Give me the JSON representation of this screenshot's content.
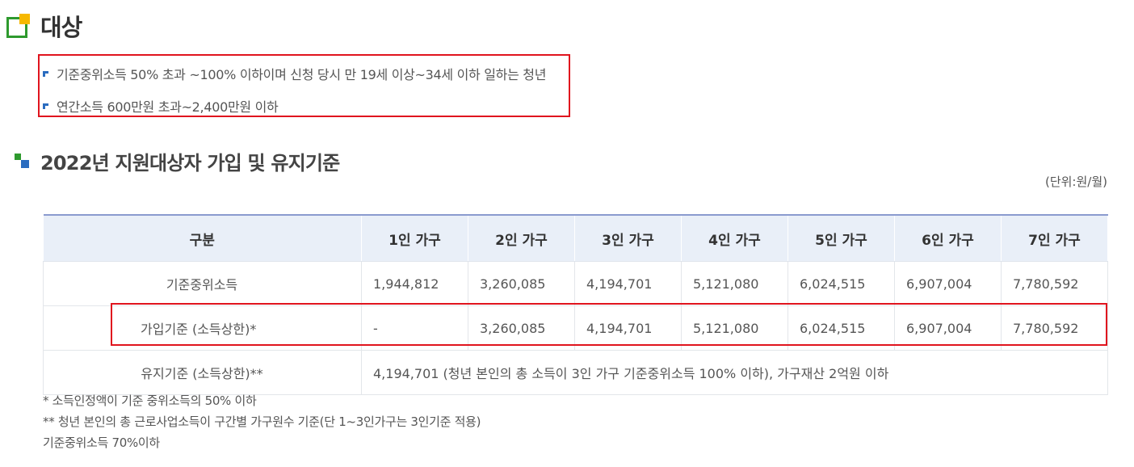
{
  "section": {
    "title": "대상"
  },
  "target": {
    "items": [
      "기준중위소득 50% 초과 ~100% 이하이며 신청 당시 만 19세 이상~34세 이하 일하는 청년",
      "연간소득 600만원 초과~2,400만원 이하"
    ]
  },
  "criteria": {
    "title": "2022년 지원대상자 가입 및 유지기준",
    "unit": "(단위:원/월)"
  },
  "table": {
    "headers": [
      "구분",
      "1인 가구",
      "2인 가구",
      "3인 가구",
      "4인 가구",
      "5인 가구",
      "6인 가구",
      "7인 가구"
    ],
    "rows": [
      {
        "label": "기준중위소득",
        "values": [
          "1,944,812",
          "3,260,085",
          "4,194,701",
          "5,121,080",
          "6,024,515",
          "6,907,004",
          "7,780,592"
        ]
      },
      {
        "label": "가입기준 (소득상한)*",
        "values": [
          "-",
          "3,260,085",
          "4,194,701",
          "5,121,080",
          "6,024,515",
          "6,907,004",
          "7,780,592"
        ]
      },
      {
        "label": "유지기준 (소득상한)**",
        "merged": "4,194,701 (청년 본인의 총 소득이 3인 가구 기준중위소득 100% 이하), 가구재산 2억원 이하"
      }
    ]
  },
  "notes": [
    "* 소득인정액이 기준 중위소득의 50% 이하",
    "** 청년 본인의 총 근로사업소득이 구간별 가구원수 기준(단 1~3인가구는 3인기준 적용)",
    "기준중위소득 70%이하"
  ],
  "colors": {
    "highlight": "#e0141e",
    "header_bg": "#e9eff8",
    "accent_green": "#2e9a2e",
    "accent_blue": "#2a6cbf",
    "accent_yellow": "#f6b800"
  }
}
